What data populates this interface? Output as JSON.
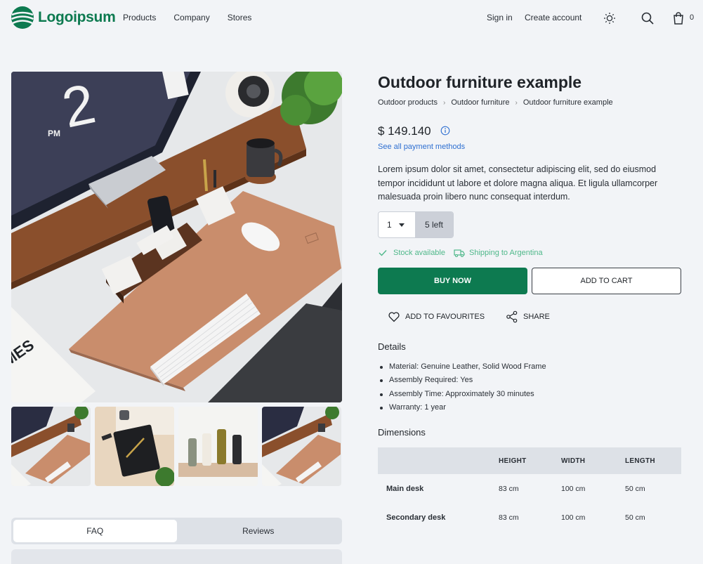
{
  "header": {
    "logo_text": "Logoipsum",
    "brand_color": "#0d7a50",
    "nav": [
      "Products",
      "Company",
      "Stores"
    ],
    "sign_in": "Sign in",
    "create_account": "Create account",
    "cart_count": "0",
    "icons": [
      "sun-icon",
      "search-icon",
      "shopping-bag-icon"
    ]
  },
  "product": {
    "title": "Outdoor furniture example",
    "breadcrumb": [
      "Outdoor products",
      "Outdoor furniture",
      "Outdoor furniture example"
    ],
    "price": "$ 149.140",
    "payment_link": "See all payment methods",
    "description": "Lorem ipsum dolor sit amet, consectetur adipiscing elit, sed do eiusmod tempor incididunt ut labore et dolore magna aliqua. Et ligula ullamcorper malesuada proin libero nunc consequat interdum.",
    "quantity": "1",
    "stock_left": "5 left",
    "stock_status": "Stock available",
    "shipping": "Shipping to Argentina",
    "buy_now": "BUY NOW",
    "add_to_cart": "ADD TO CART",
    "add_to_favourites": "ADD TO FAVOURITES",
    "share": "SHARE"
  },
  "details": {
    "title": "Details",
    "items": [
      "Material: Genuine Leather, Solid Wood Frame",
      "Assembly Required: Yes",
      "Assembly Time: Approximately 30 minutes",
      "Warranty: 1 year"
    ]
  },
  "dimensions": {
    "title": "Dimensions",
    "headers": [
      "",
      "HEIGHT",
      "WIDTH",
      "LENGTH"
    ],
    "rows": [
      [
        "Main desk",
        "83 cm",
        "100 cm",
        "50 cm"
      ],
      [
        "Secondary desk",
        "83 cm",
        "100 cm",
        "50 cm"
      ]
    ]
  },
  "tabs": [
    "FAQ",
    "Reviews"
  ],
  "active_tab": "FAQ"
}
